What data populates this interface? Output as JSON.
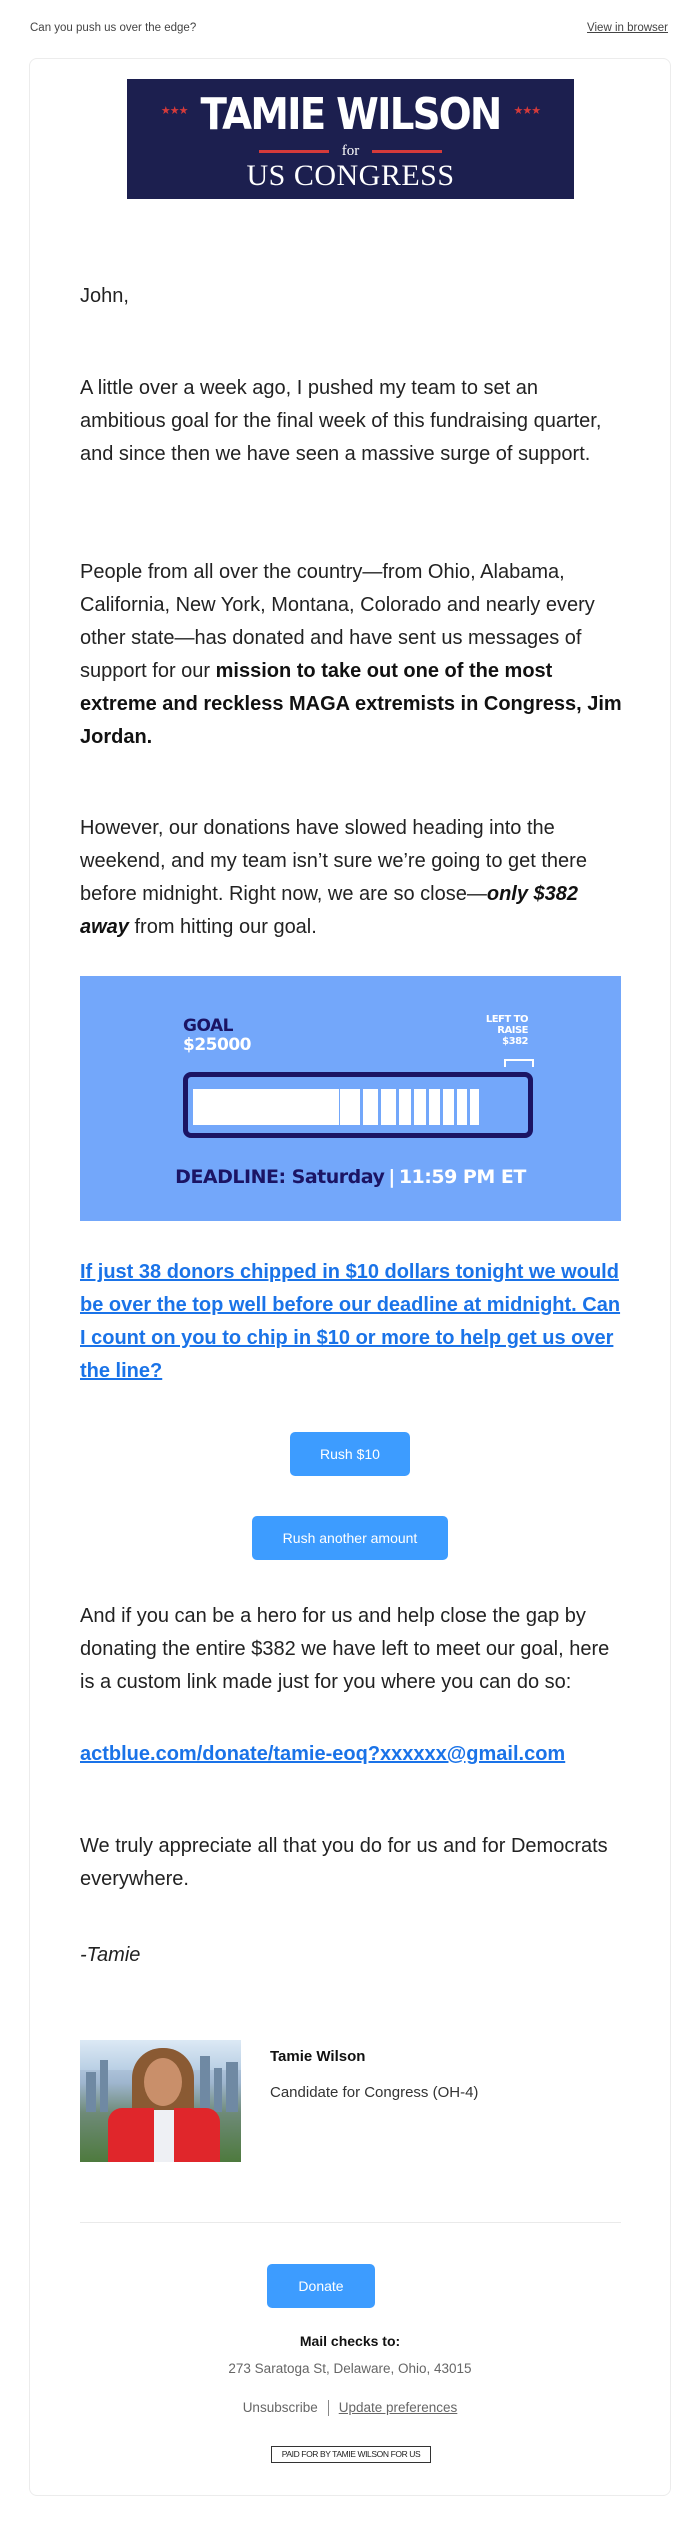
{
  "header": {
    "preheader": "Can you push us over the edge?",
    "view_in_browser": "View in browser"
  },
  "banner": {
    "name": "TAMIE WILSON",
    "stars": "★★★",
    "for": "for",
    "office": "US CONGRESS",
    "colors": {
      "background": "#1c1f4f",
      "accent": "#d53a3a"
    }
  },
  "body": {
    "greeting": "John,",
    "p1": "A little over a week ago, I pushed my team to set an ambitious goal for the final week of this fundraising quarter, and since then we have seen a massive surge of support.",
    "p2_plain": "People from all over the country—from Ohio, Alabama, California, New York, Montana, Colorado and nearly every other state—has donated and have sent us messages of support for our ",
    "p2_bold": "mission to take out one of the most extreme and reckless MAGA extremists in Congress, Jim Jordan.",
    "p3_plain": "However, our donations have slowed heading into the weekend, and my team isn’t sure we’re going to get there before midnight. Right now, we are so close—",
    "p3_bold_italic": "only $382 away",
    "p3_end": " from hitting our goal.",
    "cta_link": "If just 38 donors chipped in $10 dollars tonight we would be over the top well before our deadline at midnight. Can I count on you to chip in $10 or more to help get us over the line?",
    "p4": "And if you can be a hero for us and help close the gap by donating the entire $382 we have left to meet our goal, here is a custom link made just for you where you can do so:",
    "custom_link": "actblue.com/donate/tamie-eoq?xxxxxx@gmail.com",
    "p5": "We truly appreciate all that you do for us and for Democrats everywhere.",
    "signoff": "-Tamie"
  },
  "goal_graphic": {
    "goal_label": "GOAL",
    "goal_amount": "$25000",
    "left_to_raise_line1": "LEFT TO",
    "left_to_raise_line2": "RAISE",
    "left_to_raise_amount": "$382",
    "progress_fraction": 0.9847,
    "deadline_label": "DEADLINE: Saturday",
    "deadline_sep": "|",
    "deadline_time": "11:59 PM ET",
    "colors": {
      "background": "#73a7fa",
      "frame": "#1b1464"
    }
  },
  "buttons": {
    "rush_10": "Rush $10",
    "rush_other": "Rush another amount",
    "donate": "Donate",
    "color": "#3d9cff"
  },
  "signature": {
    "name": "Tamie Wilson",
    "title": "Candidate for Congress (OH-4)"
  },
  "footer": {
    "mail_title": "Mail checks to:",
    "address": "273 Saratoga St, Delaware, Ohio, 43015",
    "unsubscribe": "Unsubscribe",
    "update_preferences": "Update preferences",
    "paid_for": "PAID FOR BY TAMIE WILSON FOR US"
  },
  "link_color": "#1a73e8"
}
